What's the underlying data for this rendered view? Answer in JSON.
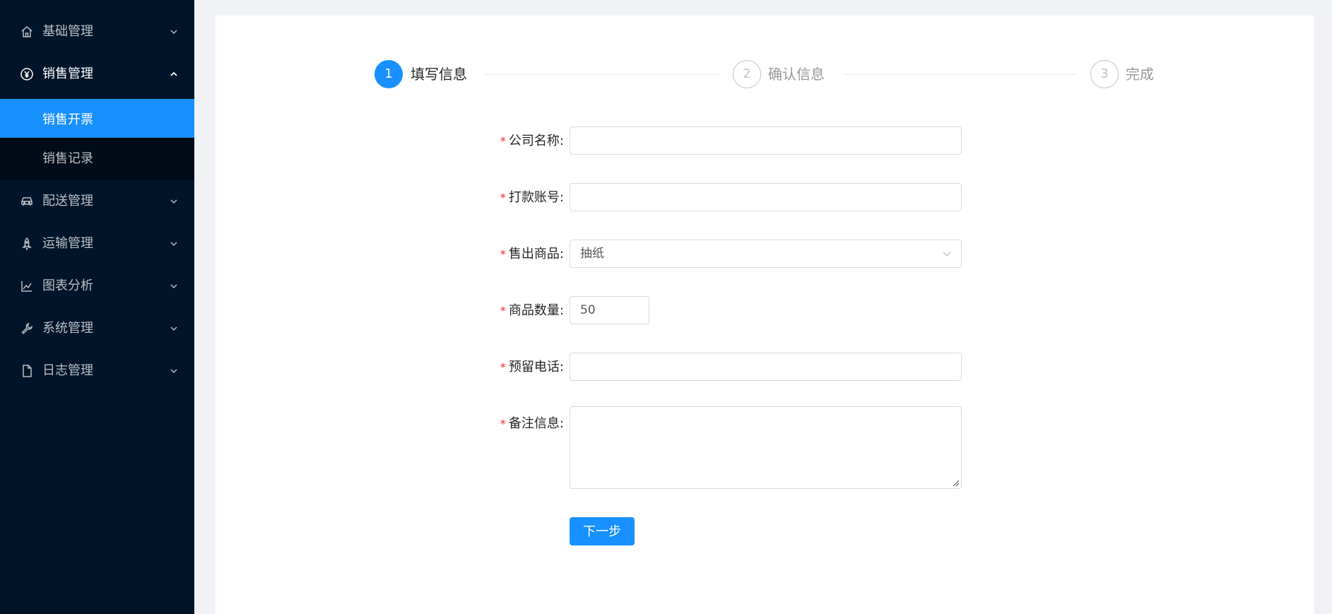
{
  "sidebar": {
    "menus": [
      {
        "label": "基础管理",
        "icon": "home-icon",
        "open": false
      },
      {
        "label": "销售管理",
        "icon": "yen-icon",
        "open": true
      },
      {
        "label": "配送管理",
        "icon": "car-icon",
        "open": false
      },
      {
        "label": "运输管理",
        "icon": "rocket-icon",
        "open": false
      },
      {
        "label": "图表分析",
        "icon": "line-chart-icon",
        "open": false
      },
      {
        "label": "系统管理",
        "icon": "wrench-icon",
        "open": false
      },
      {
        "label": "日志管理",
        "icon": "file-icon",
        "open": false
      }
    ],
    "submenu": [
      {
        "label": "销售开票",
        "active": true
      },
      {
        "label": "销售记录",
        "active": false
      }
    ]
  },
  "steps": [
    {
      "number": "1",
      "title": "填写信息",
      "active": true
    },
    {
      "number": "2",
      "title": "确认信息",
      "active": false
    },
    {
      "number": "3",
      "title": "完成",
      "active": false
    }
  ],
  "form": {
    "required_mark": "*",
    "fields": [
      {
        "label": "公司名称:",
        "value": ""
      },
      {
        "label": "打款账号:",
        "value": ""
      },
      {
        "label": "售出商品:",
        "value": "抽纸"
      },
      {
        "label": "商品数量:",
        "value": "50"
      },
      {
        "label": "预留电话:",
        "value": ""
      },
      {
        "label": "备注信息:",
        "value": ""
      }
    ],
    "next_button": "下一步"
  },
  "colors": {
    "sidebar_bg": "#001529",
    "submenu_bg": "#000c17",
    "primary": "#1890ff",
    "required": "#f5222d"
  }
}
